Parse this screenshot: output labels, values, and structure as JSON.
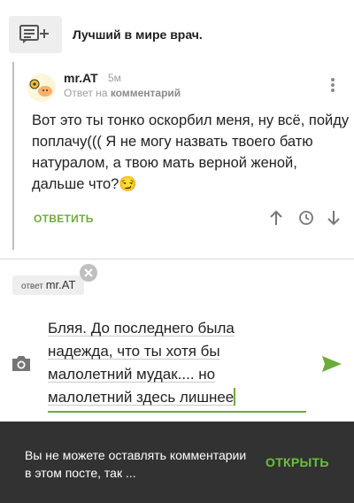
{
  "post": {
    "title": "Лучший в мире врач."
  },
  "comment": {
    "author": "mr.AT",
    "time": "5м",
    "reply_to_prefix": "Ответ на",
    "reply_to_link": "комментарий",
    "text": "Вот это ты тонко оскорбил меня, ну всё, пойду поплачу((( Я не могу назвать твоего батю натуралом, а твою мать верной женой, дальше что?😏",
    "reply_label": "ОТВЕТИТЬ",
    "icons": [
      "upvote-icon",
      "clock-icon",
      "downvote-icon",
      "more-vertical-icon"
    ]
  },
  "composer": {
    "reply_chip_prefix": "ответ",
    "reply_chip_nick": "mr.AT",
    "lines": [
      "Бляя. До последнего была",
      "надежда, что ты хотя бы",
      "малолетний мудак.... но",
      "малолетний здесь лишнее"
    ]
  },
  "snackbar": {
    "message": "Вы не можете оставлять комментарии в этом посте, так ...",
    "action_label": "ОТКРЫТЬ"
  },
  "colors": {
    "accent": "#6bad3a",
    "snackbar_bg": "#323232"
  }
}
